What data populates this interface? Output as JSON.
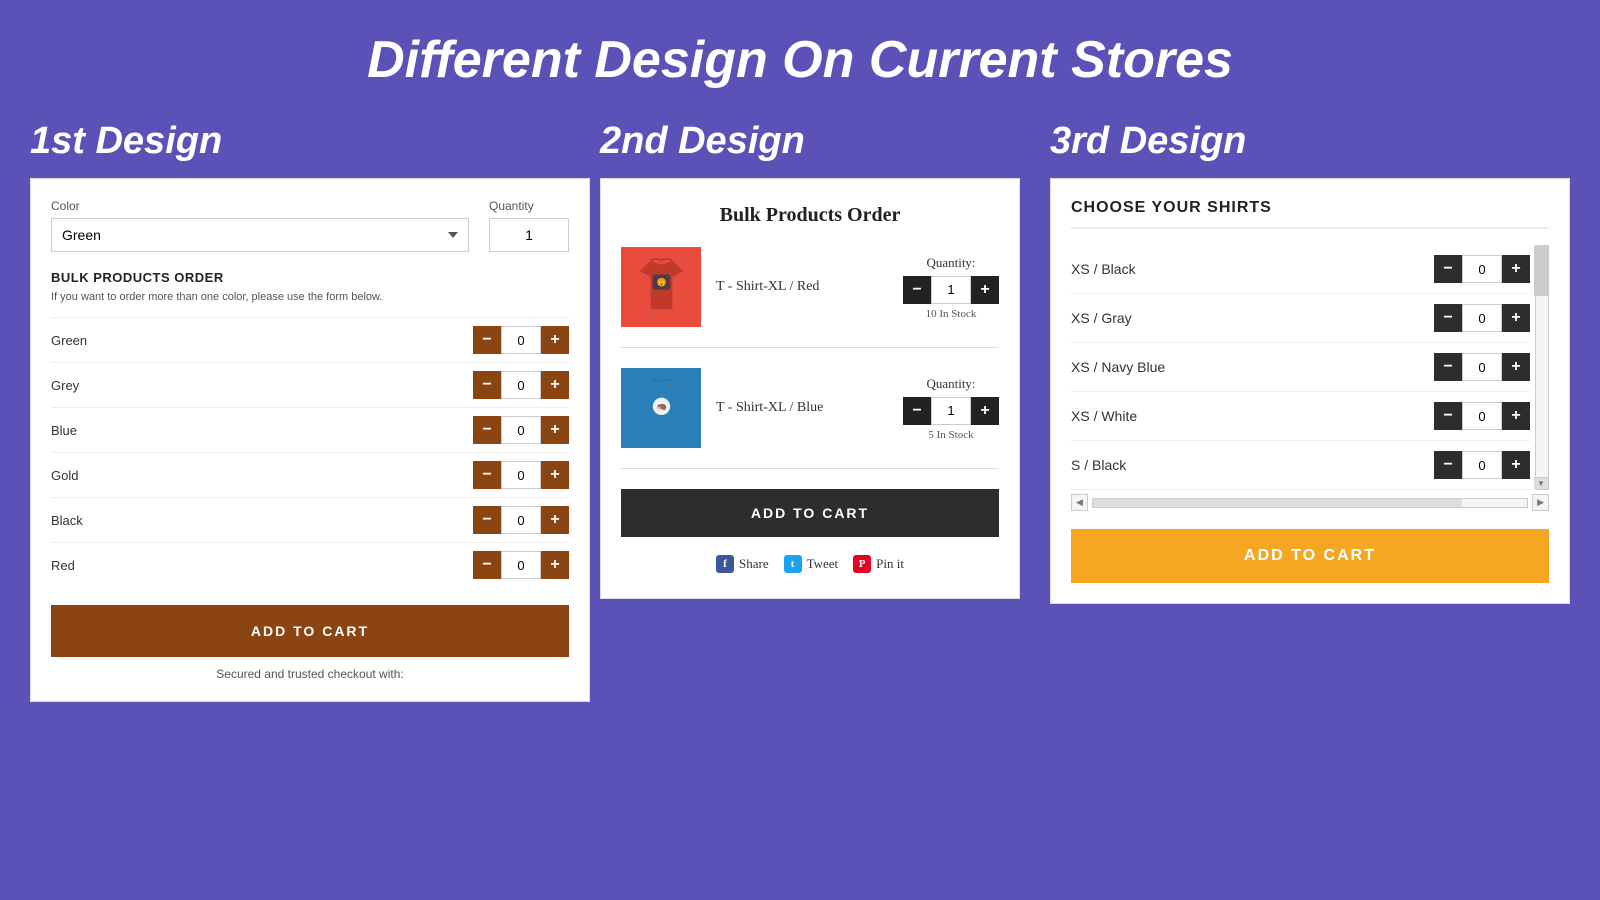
{
  "page": {
    "title": "Different Design On Current Stores",
    "bg_color": "#5b52b8"
  },
  "design1": {
    "label": "1st Design",
    "color_label": "Color",
    "qty_label": "Quantity",
    "color_value": "Green",
    "qty_value": "1",
    "color_options": [
      "Green",
      "Grey",
      "Blue",
      "Gold",
      "Black",
      "Red"
    ],
    "bulk_title": "BULK PRODUCTS ORDER",
    "bulk_subtitle": "If you want to order more than one color, please use the form below.",
    "rows": [
      {
        "label": "Green",
        "qty": "0"
      },
      {
        "label": "Grey",
        "qty": "0"
      },
      {
        "label": "Blue",
        "qty": "0"
      },
      {
        "label": "Gold",
        "qty": "0"
      },
      {
        "label": "Black",
        "qty": "0"
      },
      {
        "label": "Red",
        "qty": "0"
      }
    ],
    "add_to_cart": "ADD TO CART",
    "secure_text": "Secured and trusted checkout with:"
  },
  "design2": {
    "label": "2nd Design",
    "title": "Bulk Products Order",
    "products": [
      {
        "name": "T - Shirt-XL / Red",
        "qty": "1",
        "stock": "10 In Stock",
        "color": "red"
      },
      {
        "name": "T - Shirt-XL / Blue",
        "qty": "1",
        "stock": "5 In Stock",
        "color": "blue"
      }
    ],
    "add_to_cart": "ADD TO CART",
    "social": [
      {
        "label": "Share",
        "icon": "f",
        "type": "fb"
      },
      {
        "label": "Tweet",
        "icon": "t",
        "type": "tw"
      },
      {
        "label": "Pin it",
        "icon": "p",
        "type": "pi"
      }
    ]
  },
  "design3": {
    "label": "3rd Design",
    "title": "CHOOSE YOUR SHIRTS",
    "rows": [
      {
        "label": "XS / Black",
        "qty": "0"
      },
      {
        "label": "XS / Gray",
        "qty": "0"
      },
      {
        "label": "XS / Navy Blue",
        "qty": "0"
      },
      {
        "label": "XS / White",
        "qty": "0"
      },
      {
        "label": "S / Black",
        "qty": "0"
      }
    ],
    "add_to_cart": "ADD TO CART"
  }
}
